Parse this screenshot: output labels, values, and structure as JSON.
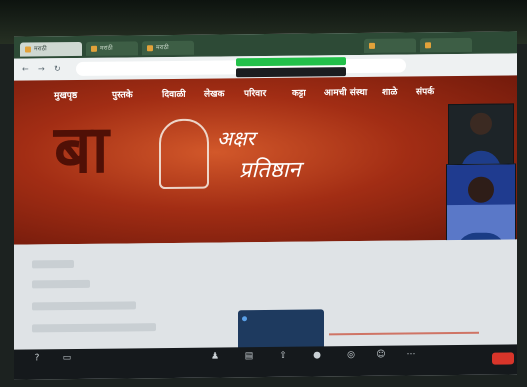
{
  "browser": {
    "tabs": [
      {
        "label": "मराठी"
      },
      {
        "label": "मराठी"
      },
      {
        "label": "मराठी"
      },
      {
        "label": ""
      },
      {
        "label": ""
      }
    ],
    "url": "",
    "profile": ""
  },
  "share": {
    "label": ""
  },
  "site": {
    "menu": [
      "मुखपृष्ठ",
      "पुस्तके",
      "दिवाळी",
      "लेखक",
      "परिवार",
      "कट्टा",
      "आमची संस्था",
      "शाळे",
      "संपर्क"
    ],
    "logo_line1": "अक्षर",
    "logo_line2": "प्रतिष्ठान",
    "big_letters": "बा"
  },
  "content": {
    "lines": [
      "",
      "",
      "",
      ""
    ]
  },
  "popup": {
    "line1": "",
    "line2": ""
  },
  "zoom": {
    "buttons": [
      {
        "icon": "?",
        "label": ""
      },
      {
        "icon": "▭",
        "label": ""
      },
      {
        "icon": "♟",
        "label": ""
      },
      {
        "icon": "▤",
        "label": ""
      },
      {
        "icon": "⇧",
        "label": ""
      },
      {
        "icon": "●",
        "label": ""
      },
      {
        "icon": "◎",
        "label": ""
      },
      {
        "icon": "☺",
        "label": ""
      },
      {
        "icon": "⋯",
        "label": ""
      }
    ],
    "end_label": ""
  }
}
